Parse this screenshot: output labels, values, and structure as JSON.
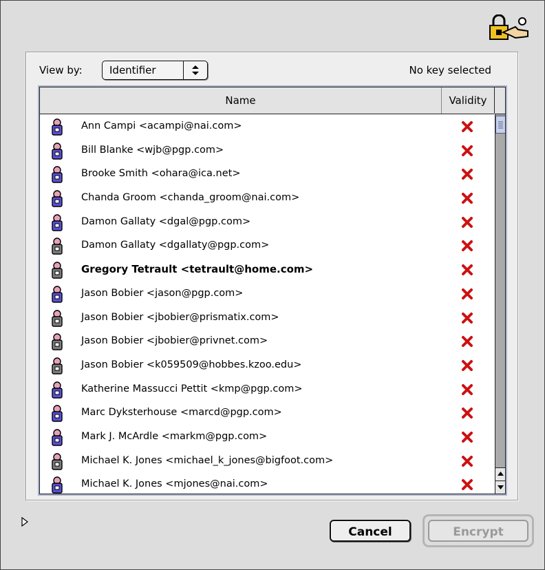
{
  "header": {
    "view_by_label": "View by:",
    "view_by_value": "Identifier",
    "status": "No key selected"
  },
  "list": {
    "columns": {
      "name": "Name",
      "validity": "Validity"
    },
    "rows": [
      {
        "name": "Ann Campi <acampi@nai.com>",
        "key_icon": "dh-key-icon",
        "validity": "invalid",
        "bold": false
      },
      {
        "name": "Bill Blanke <wjb@pgp.com>",
        "key_icon": "dh-key-icon",
        "validity": "invalid",
        "bold": false
      },
      {
        "name": "Brooke Smith <ohara@ica.net>",
        "key_icon": "dh-key-icon",
        "validity": "invalid",
        "bold": false
      },
      {
        "name": "Chanda Groom <chanda_groom@nai.com>",
        "key_icon": "dh-key-icon",
        "validity": "invalid",
        "bold": false
      },
      {
        "name": "Damon Gallaty <dgal@pgp.com>",
        "key_icon": "dh-key-icon",
        "validity": "invalid",
        "bold": false
      },
      {
        "name": "Damon Gallaty <dgallaty@pgp.com>",
        "key_icon": "rsa-key-icon",
        "validity": "invalid",
        "bold": false
      },
      {
        "name": "Gregory Tetrault <tetrault@home.com>",
        "key_icon": "rsa-key-icon",
        "validity": "invalid",
        "bold": true
      },
      {
        "name": "Jason Bobier <jason@pgp.com>",
        "key_icon": "dh-key-icon",
        "validity": "invalid",
        "bold": false
      },
      {
        "name": "Jason Bobier <jbobier@prismatix.com>",
        "key_icon": "rsa-key-icon",
        "validity": "invalid",
        "bold": false
      },
      {
        "name": "Jason Bobier <jbobier@privnet.com>",
        "key_icon": "rsa-key-icon",
        "validity": "invalid",
        "bold": false
      },
      {
        "name": "Jason Bobier <k059509@hobbes.kzoo.edu>",
        "key_icon": "rsa-key-icon",
        "validity": "invalid",
        "bold": false
      },
      {
        "name": "Katherine Massucci Pettit <kmp@pgp.com>",
        "key_icon": "dh-key-icon",
        "validity": "invalid",
        "bold": false
      },
      {
        "name": "Marc Dyksterhouse <marcd@pgp.com>",
        "key_icon": "dh-key-icon",
        "validity": "invalid",
        "bold": false
      },
      {
        "name": "Mark J. McArdle <markm@pgp.com>",
        "key_icon": "dh-key-icon",
        "validity": "invalid",
        "bold": false
      },
      {
        "name": "Michael K. Jones <michael_k_jones@bigfoot.com>",
        "key_icon": "rsa-key-icon",
        "validity": "invalid",
        "bold": false
      },
      {
        "name": "Michael K. Jones <mjones@nai.com>",
        "key_icon": "dh-key-icon",
        "validity": "invalid",
        "bold": false
      }
    ]
  },
  "buttons": {
    "cancel": "Cancel",
    "encrypt": "Encrypt"
  },
  "colors": {
    "invalid_x": "#cc1111",
    "dh_key_body": "#5a4fd8",
    "rsa_key_body": "#7d7d7d",
    "key_head": "#e7a1b6"
  }
}
